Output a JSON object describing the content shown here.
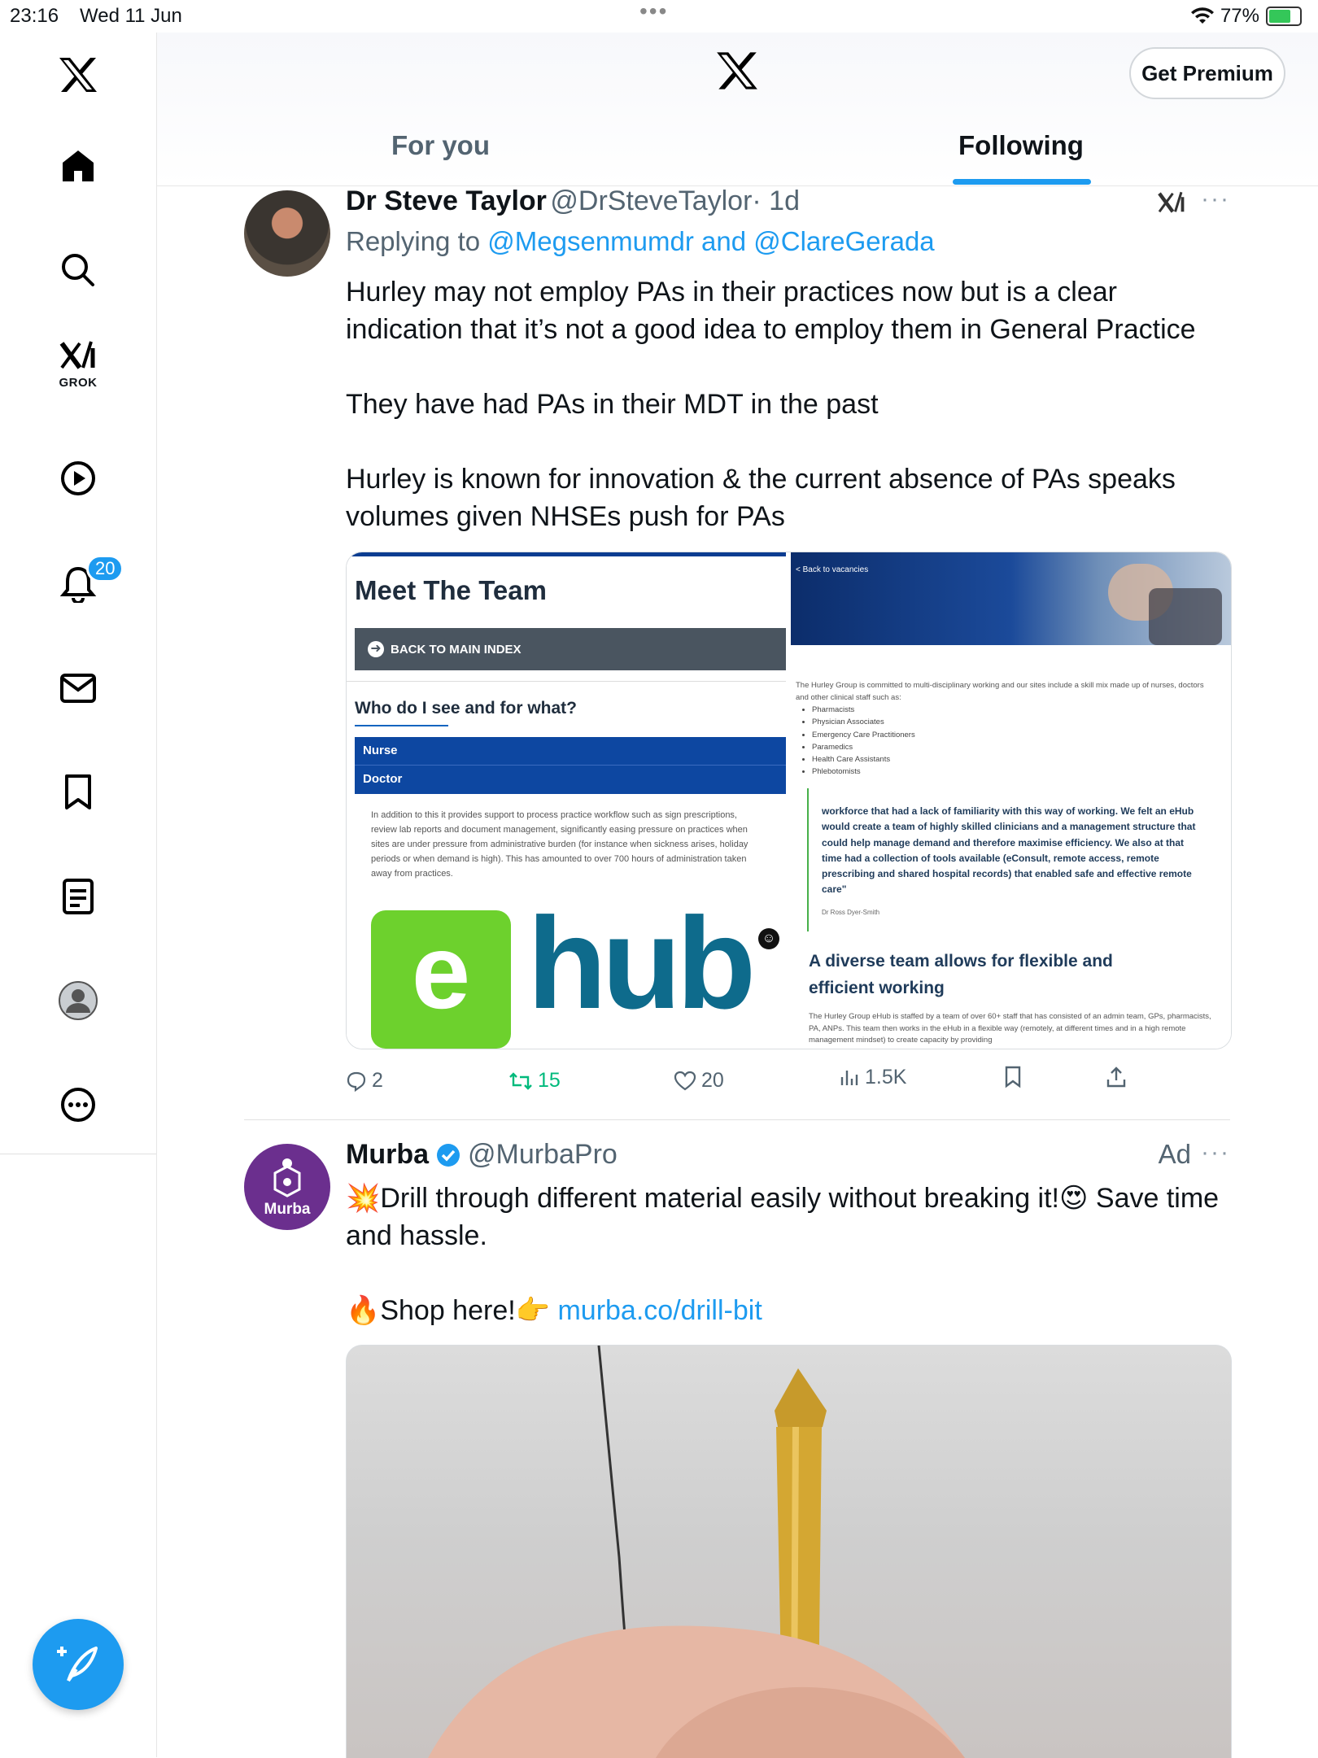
{
  "status_bar": {
    "time": "23:16",
    "date": "Wed 11 Jun",
    "battery": "77%",
    "battery_level": 0.77
  },
  "sidebar": {
    "items": [
      {
        "name": "home-icon"
      },
      {
        "name": "search-icon"
      },
      {
        "name": "grok-icon",
        "label": "GROK"
      },
      {
        "name": "video-icon"
      },
      {
        "name": "notifications-icon",
        "badge": "20"
      },
      {
        "name": "messages-icon"
      },
      {
        "name": "bookmarks-icon"
      },
      {
        "name": "lists-icon"
      },
      {
        "name": "profile-icon"
      },
      {
        "name": "more-icon"
      }
    ]
  },
  "header": {
    "premium": "Get Premium",
    "tabs": [
      {
        "label": "For you"
      },
      {
        "label": "Following"
      }
    ],
    "active_tab": "Following"
  },
  "tweet1": {
    "name": "Dr Steve Taylor",
    "handle": "@DrSteveTaylor",
    "time": "· 1d",
    "replying_prefix": "Replying to ",
    "replying_to": "@Megsenmumdr and @ClareGerada",
    "paragraphs": [
      "Hurley may not employ PAs in their practices now but is a clear indication that it’s not a good idea to employ them in General Practice",
      "They have had PAs in their MDT in the past",
      "Hurley is known for innovation & the current absence of PAs speaks volumes given NHSEs push for PAs"
    ],
    "image_left": {
      "title": "Meet The Team",
      "back_button": "BACK TO MAIN INDEX",
      "question": "Who do I see and for what?",
      "list": [
        "Nurse",
        "Doctor"
      ],
      "text": "In addition to this it provides support to process practice workflow such as sign prescriptions, review lab reports and document management, significantly easing pressure on practices when sites are under pressure from administrative burden (for instance when sickness arises, holiday periods or when demand is high). This has amounted to over 700 hours of administration taken away from practices.",
      "logo_e": "e",
      "logo_hub": "hub"
    },
    "image_right": {
      "back": "< Back to vacancies",
      "intro": "The Hurley Group is committed to multi-disciplinary working and our sites include a skill mix made up of nurses, doctors and other clinical staff such as:",
      "roles": [
        "Pharmacists",
        "Physician Associates",
        "Emergency Care Practitioners",
        "Paramedics",
        "Health Care Assistants",
        "Phlebotomists"
      ],
      "quote": "workforce that had a lack of familiarity with this way of working. We felt an eHub would create a team of highly skilled clinicians and a management structure that could help manage demand and therefore maximise efficiency. We also at that time had a collection of tools available (eConsult, remote access, remote prescribing and shared hospital records) that enabled safe and effective remote care\"",
      "quote_author": "Dr Ross Dyer-Smith",
      "heading": "A diverse team allows for flexible and efficient working",
      "footer": "The Hurley Group eHub is staffed by a team of over 60+ staff that has consisted of an admin team, GPs, pharmacists, PA, ANPs. This team then works in the eHub in a flexible way (remotely, at different times and in a high remote management mindset) to create capacity by providing"
    },
    "actions": {
      "replies": "2",
      "reposts": "15",
      "likes": "20",
      "views": "1.5K"
    }
  },
  "tweet2": {
    "name": "Murba",
    "handle": "@MurbaPro",
    "ad_label": "Ad",
    "avatar_text": "Murba",
    "line1": "💥Drill through different material easily without breaking it!😍 Save time and hassle.",
    "shop": "🔥Shop here!👉 ",
    "link": "murba.co/drill-bit"
  },
  "colors": {
    "accent": "#1d9bf0",
    "repost": "#00ba7c",
    "murba": "#6b2f8e"
  }
}
